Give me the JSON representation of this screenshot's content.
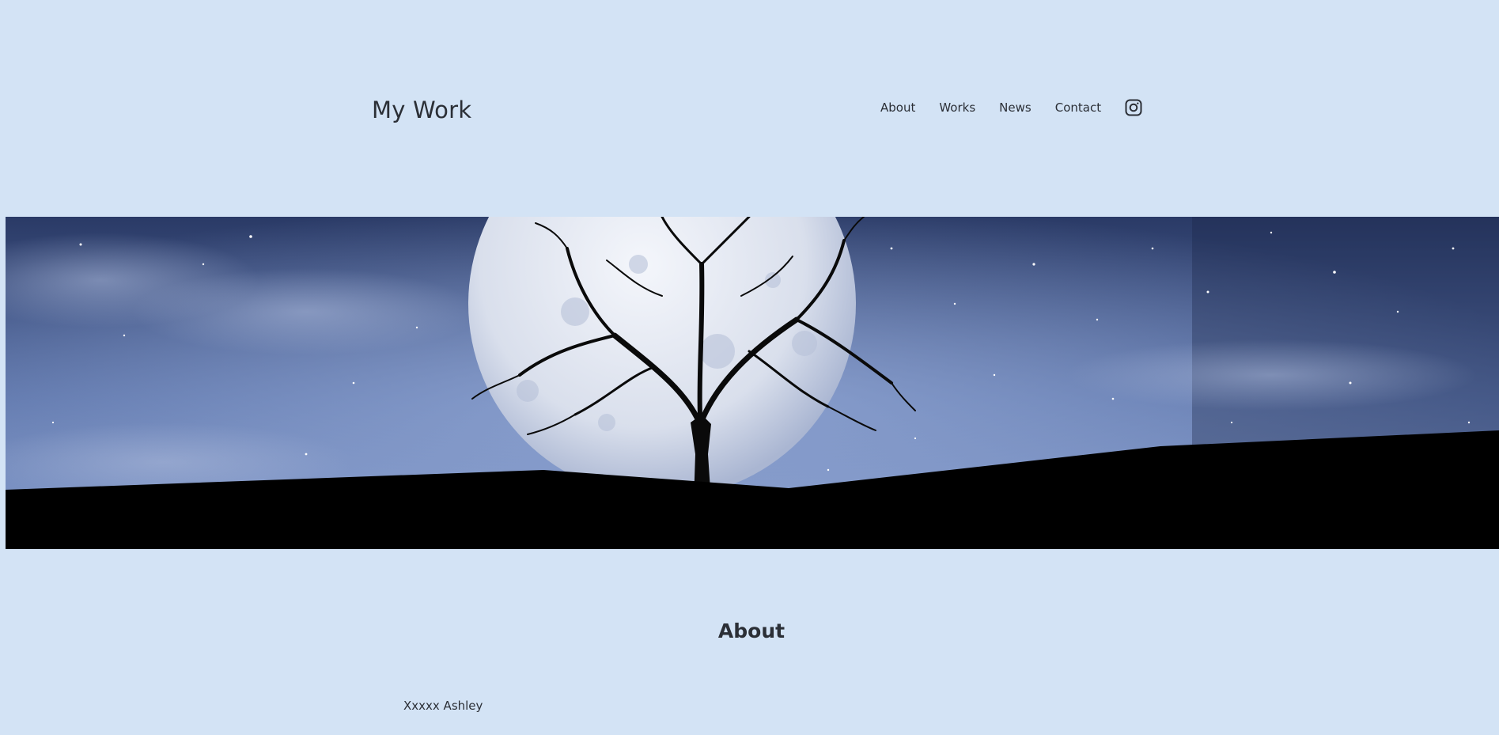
{
  "header": {
    "site_title": "My Work",
    "nav": [
      {
        "label": "About"
      },
      {
        "label": "Works"
      },
      {
        "label": "News"
      },
      {
        "label": "Contact"
      }
    ],
    "social_icon": "instagram-icon"
  },
  "hero": {
    "description_icon": "moon-tree-night-image"
  },
  "about": {
    "heading": "About",
    "name_text": "Xxxxx Ashley"
  },
  "colors": {
    "background": "#d3e3f5",
    "text": "#2b2f36",
    "sky_dark": "#1c2b50",
    "sky_light": "#7f95c4",
    "ground": "#000000"
  }
}
